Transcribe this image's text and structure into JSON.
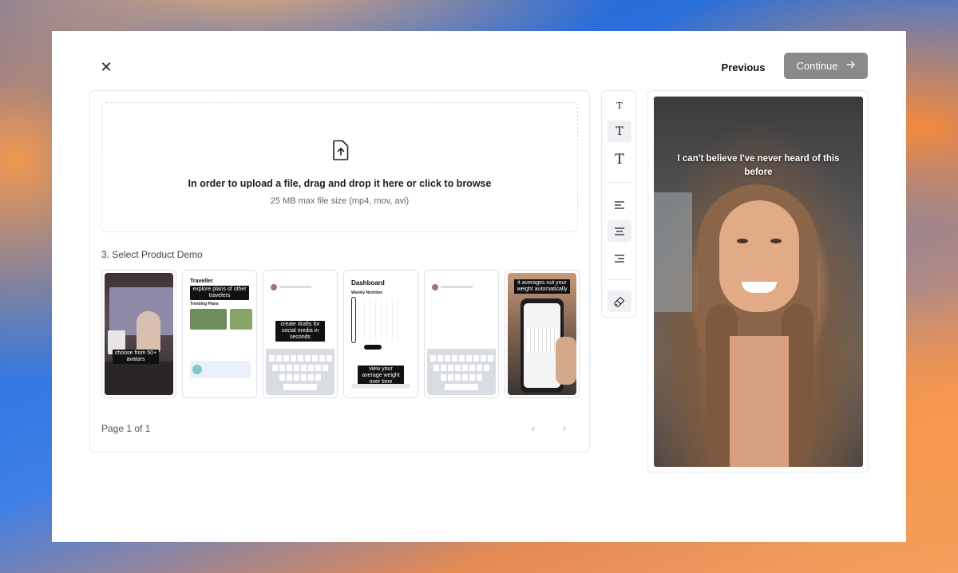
{
  "header": {
    "close_icon": "close-icon",
    "previous_label": "Previous",
    "continue_label": "Continue",
    "continue_icon": "arrow-right-icon",
    "continue_bg": "#8a8a8a"
  },
  "upload": {
    "icon": "file-upload-icon",
    "title": "In order to upload a file, drag and drop it here or click to browse",
    "subtitle": "25 MB max file size (mp4, mov, avi)"
  },
  "product_demo": {
    "section_title": "3. Select Product Demo",
    "thumbnails": [
      {
        "caption": "choose from 50+ avatars"
      },
      {
        "caption": "explore plans of other travelers",
        "title": "Traveller",
        "section": "Trending Plans"
      },
      {
        "caption": "create drafts for social media in seconds"
      },
      {
        "caption": "view your average weight over time",
        "title": "Dashboard",
        "section": "Weekly Nutrition"
      },
      {
        "caption": ""
      },
      {
        "caption": "it averages out your weight automatically"
      }
    ],
    "page_label": "Page 1 of 1",
    "prev_icon": "chevron-left-icon",
    "next_icon": "chevron-right-icon"
  },
  "toolbar": {
    "tools": [
      {
        "name": "text-small-icon",
        "glyph": "T"
      },
      {
        "name": "text-medium-icon",
        "glyph": "T"
      },
      {
        "name": "text-large-icon",
        "glyph": "T"
      },
      {
        "name": "align-left-icon"
      },
      {
        "name": "align-center-icon"
      },
      {
        "name": "align-right-icon"
      },
      {
        "name": "paint-brush-icon"
      }
    ]
  },
  "preview": {
    "overlay_text": "I can't believe I've never heard of this before"
  }
}
